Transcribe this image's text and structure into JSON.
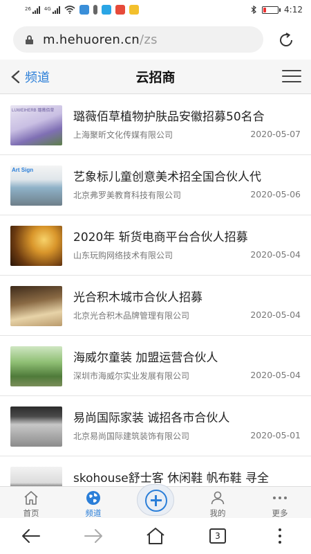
{
  "status_bar": {
    "signal_1_label": "26",
    "signal_2_label": "4G",
    "time": "4:12",
    "battery_level": 0.2
  },
  "browser": {
    "url_host": "m.hehuoren.cn",
    "url_path": "/zs",
    "tab_count": "3"
  },
  "header": {
    "back_label": "频道",
    "title": "云招商"
  },
  "items": [
    {
      "title": "璐薇佰草植物护肤品安徽招募50名合",
      "company": "上海聚昕文化传媒有限公司",
      "date": "2020-05-07",
      "thumb_text": "LUWEIHERB 璐薇佰草"
    },
    {
      "title": "艺象标儿童创意美术招全国合伙人代",
      "company": "北京弗罗美教育科技有限公司",
      "date": "2020-05-06",
      "thumb_text": "Art Sign"
    },
    {
      "title": "2020年 斩货电商平台合伙人招募",
      "company": "山东玩购网络技术有限公司",
      "date": "2020-05-04",
      "thumb_text": ""
    },
    {
      "title": "光合积木城市合伙人招募",
      "company": "北京光合积木品牌管理有限公司",
      "date": "2020-05-04",
      "thumb_text": ""
    },
    {
      "title": "海威尔童装 加盟运营合伙人",
      "company": "深圳市海威尔实业发展有限公司",
      "date": "2020-05-04",
      "thumb_text": ""
    },
    {
      "title": "易尚国际家装 诚招各市合伙人",
      "company": "北京易尚国际建筑装饰有限公司",
      "date": "2020-05-01",
      "thumb_text": ""
    },
    {
      "title": "skohouse舒士客 休闲鞋 帆布鞋 寻全",
      "company": "",
      "date": "",
      "thumb_text": ""
    }
  ],
  "tabbar": {
    "home": "首页",
    "channel": "频道",
    "mine": "我的",
    "more": "更多"
  },
  "colors": {
    "accent": "#2a7ed8",
    "header_bg": "#f6f6f6"
  }
}
